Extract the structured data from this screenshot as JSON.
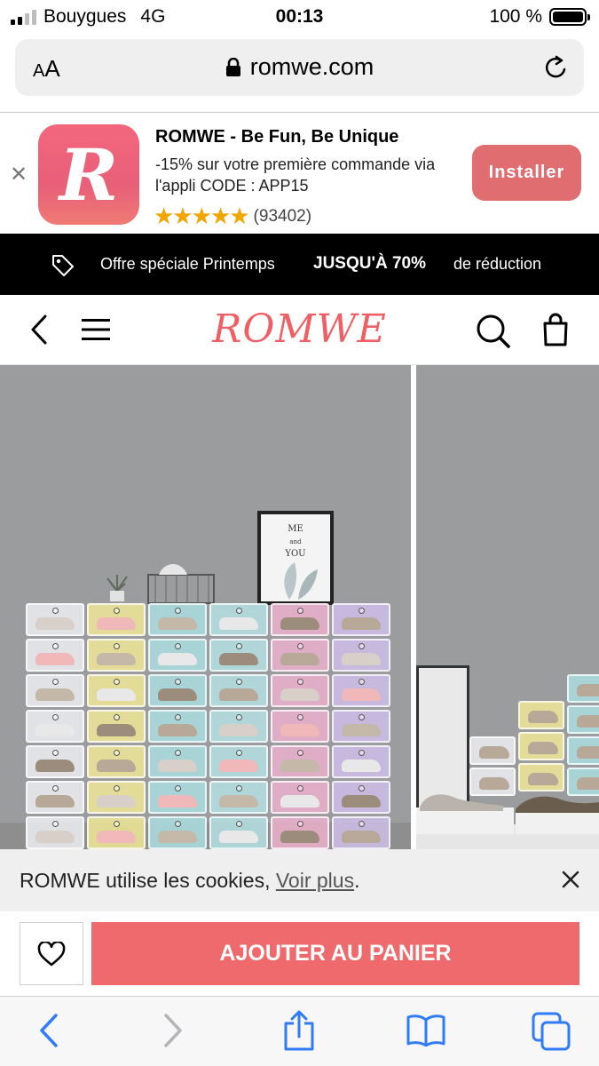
{
  "status_bar": {
    "carrier": "Bouygues",
    "network": "4G",
    "time": "00:13",
    "battery": "100 %",
    "signal_bars": 4,
    "signal_bars_active": 2
  },
  "browser": {
    "text_size_label_small": "A",
    "text_size_label_large": "A",
    "url": "romwe.com",
    "icons": [
      "lock-icon",
      "reload-icon"
    ]
  },
  "app_banner": {
    "title": "ROMWE - Be Fun, Be Unique",
    "subtitle": "-15% sur votre première commande via l'appli CODE : APP15",
    "stars": "★★★★★",
    "rating_count": "(93402)",
    "install_label": "Installer",
    "close_symbol": "✕",
    "icon_letter": "R",
    "icon_color": "#ee6579",
    "install_color": "#e06d70"
  },
  "promo": {
    "text": "Offre spéciale Printemps",
    "highlight": "JUSQU'À 70%",
    "suffix": "de réduction"
  },
  "header": {
    "logo": "ROMWE",
    "logo_color": "#ef5f63"
  },
  "gallery": {
    "frame_text_line1": "ME",
    "frame_text_line2": "and",
    "frame_text_line3": "YOU"
  },
  "cookie": {
    "text": "ROMWE utilise les cookies, ",
    "link": "Voir plus",
    "end": "."
  },
  "actions": {
    "add_to_cart": "AJOUTER AU PANIER",
    "cart_color": "#ee6a6d"
  }
}
